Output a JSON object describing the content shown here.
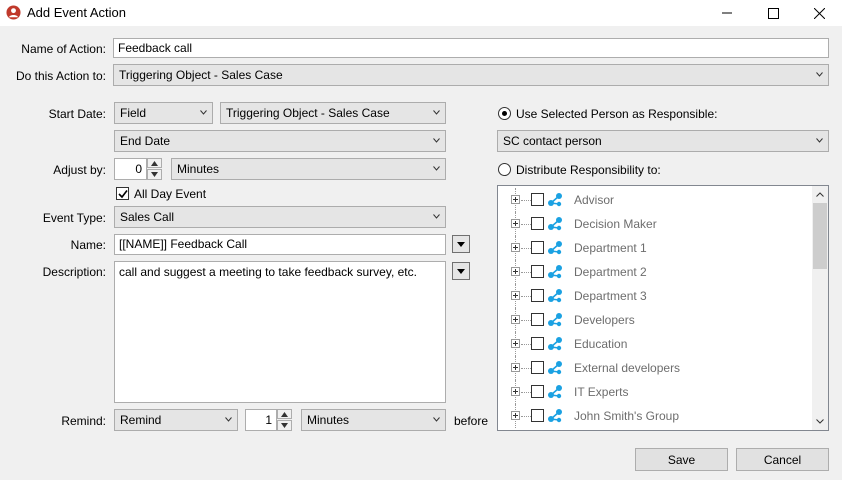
{
  "window": {
    "title": "Add Event Action"
  },
  "form": {
    "name_label": "Name of Action:",
    "name_value": "Feedback call",
    "do_label": "Do this Action to:",
    "do_value": "Triggering Object - Sales Case",
    "start_label": "Start Date:",
    "start_type": "Field",
    "start_object": "Triggering Object - Sales Case",
    "start_field": "End Date",
    "adjust_label": "Adjust by:",
    "adjust_value": "0",
    "adjust_unit": "Minutes",
    "allday_label": "All Day Event",
    "allday_checked": true,
    "type_label": "Event Type:",
    "type_value": "Sales Call",
    "evname_label": "Name:",
    "evname_value": "[[NAME]] Feedback Call",
    "desc_label": "Description:",
    "desc_value": "call and suggest a meeting to take feedback survey, etc.",
    "remind_label": "Remind:",
    "remind_value": "Remind",
    "remind_amount": "1",
    "remind_unit": "Minutes",
    "before_label": "before"
  },
  "responsible": {
    "use_selected_label": "Use Selected Person as Responsible:",
    "use_selected_checked": true,
    "person_value": "SC contact person",
    "distribute_label": "Distribute Responsibility to:",
    "distribute_checked": false,
    "groups": [
      {
        "label": "Advisor"
      },
      {
        "label": "Decision Maker"
      },
      {
        "label": "Department 1"
      },
      {
        "label": "Department 2"
      },
      {
        "label": "Department 3"
      },
      {
        "label": "Developers"
      },
      {
        "label": "Education"
      },
      {
        "label": "External developers"
      },
      {
        "label": "IT Experts"
      },
      {
        "label": "John Smith's Group"
      }
    ]
  },
  "buttons": {
    "save": "Save",
    "cancel": "Cancel"
  },
  "colors": {
    "group_icon": "#1ba1e2",
    "app_icon": "#c0392b"
  }
}
